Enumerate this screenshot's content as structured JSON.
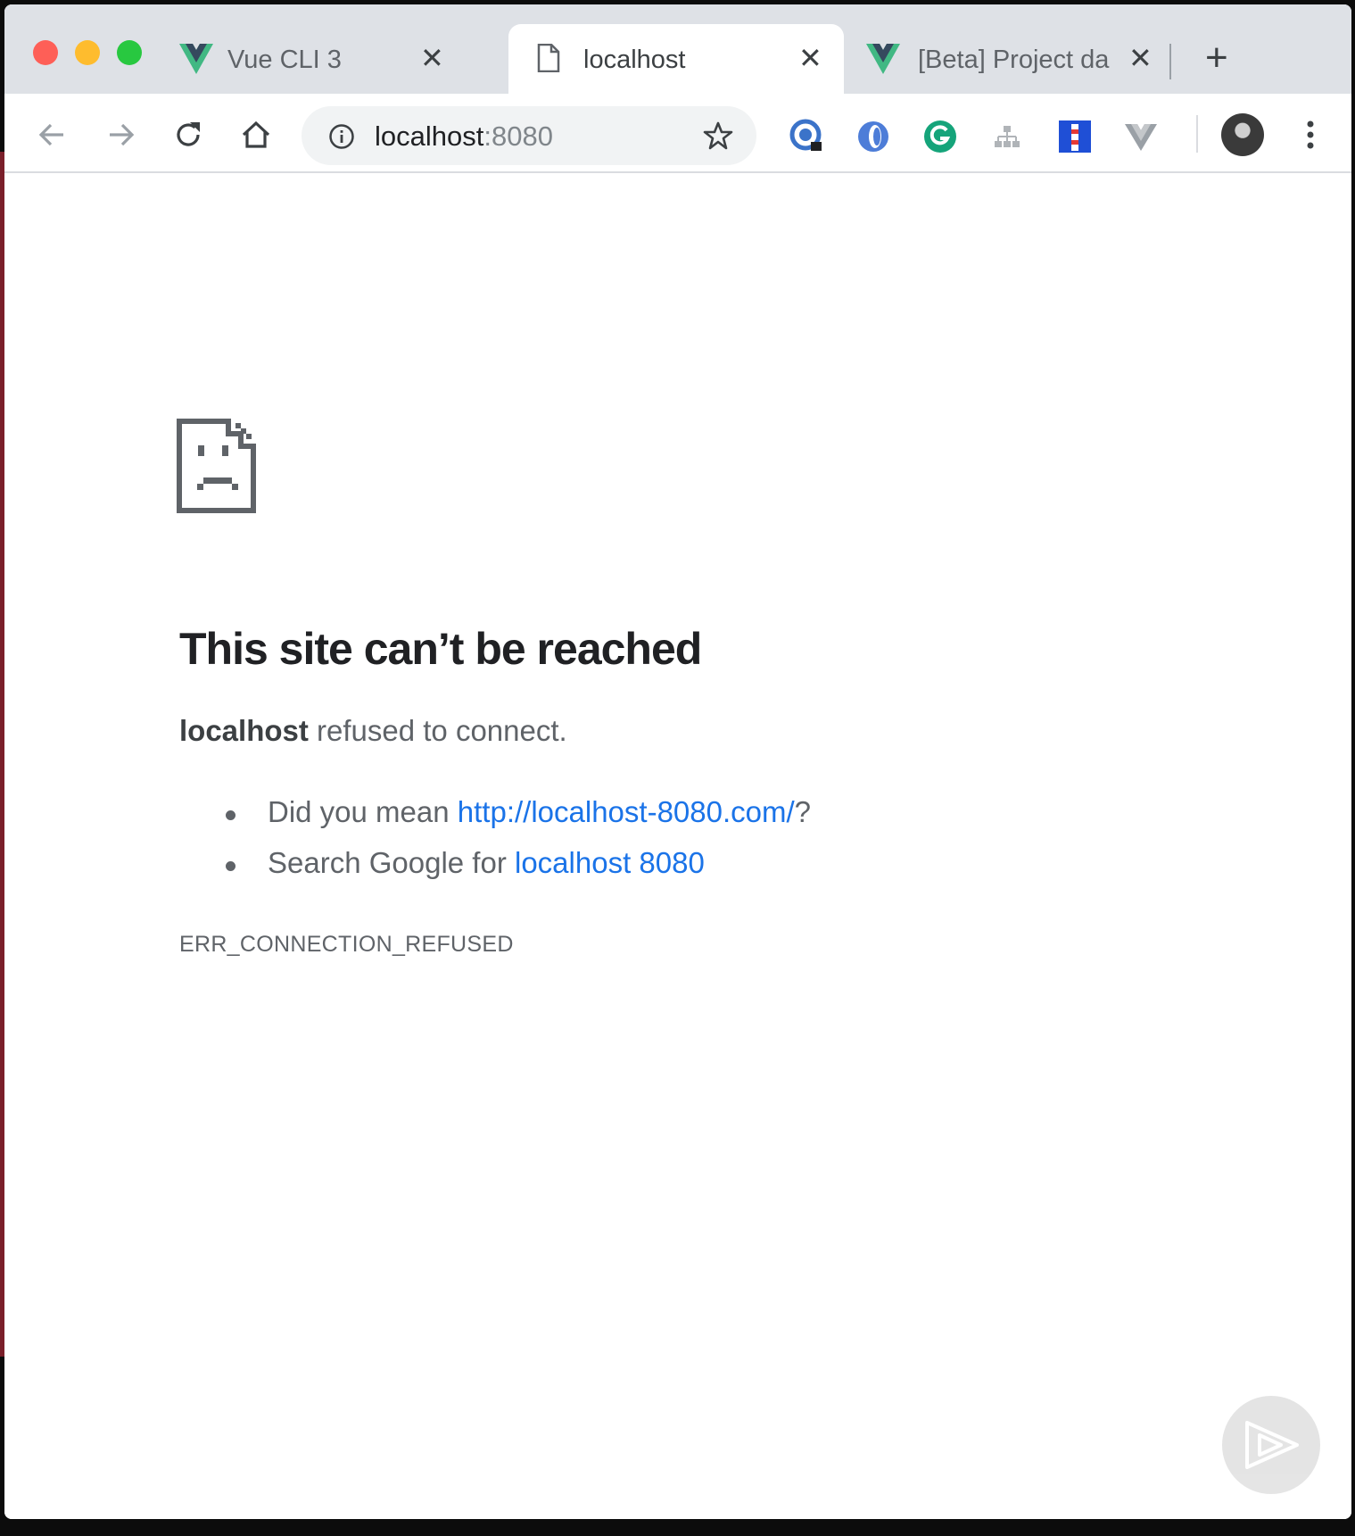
{
  "browser": {
    "tabs": [
      {
        "title": "Vue CLI 3",
        "icon": "vue-logo-icon",
        "active": false
      },
      {
        "title": "localhost",
        "icon": "document-icon",
        "active": true
      },
      {
        "title": "[Beta] Project da",
        "icon": "vue-logo-icon",
        "active": false
      }
    ],
    "close_glyph": "✕",
    "new_tab_glyph": "+",
    "address": {
      "host": "localhost",
      "port": ":8080"
    },
    "extensions": [
      "password-manager-icon",
      "blue-swirl-icon",
      "grammarly-icon",
      "sitemap-icon",
      "lighthouse-icon",
      "vue-devtools-icon"
    ]
  },
  "error_page": {
    "heading": "This site can’t be reached",
    "host": "localhost",
    "message": " refused to connect.",
    "suggestions": [
      {
        "prefix": "Did you mean ",
        "link": "http://localhost-8080.com/",
        "suffix": "?"
      },
      {
        "prefix": "Search Google for ",
        "link": "localhost 8080",
        "suffix": ""
      }
    ],
    "error_code": "ERR_CONNECTION_REFUSED"
  },
  "colors": {
    "tab_strip": "#dee1e6",
    "link": "#1a73e8",
    "vue_green": "#41b883",
    "vue_dark": "#35495e"
  }
}
